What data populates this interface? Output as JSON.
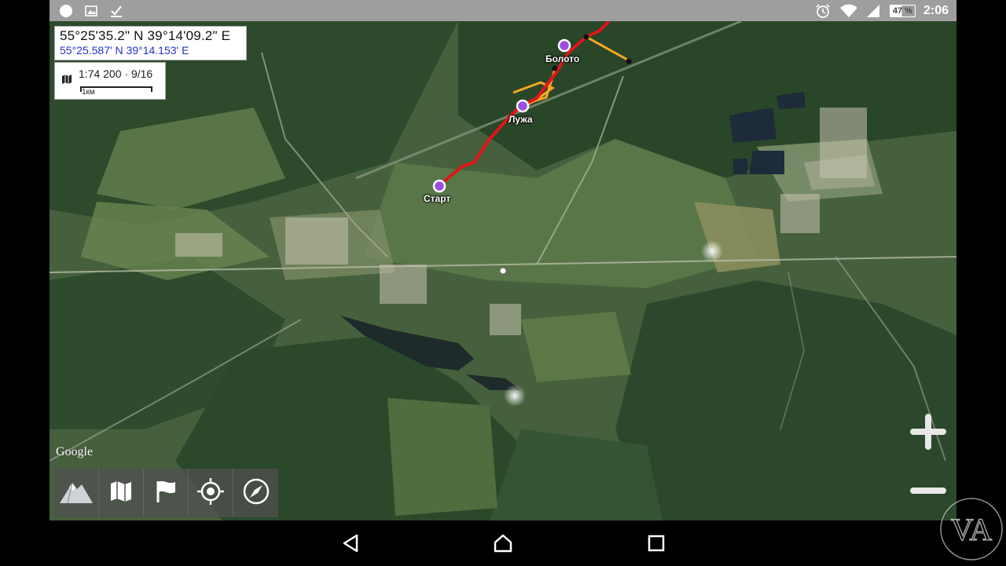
{
  "status_bar": {
    "left_icons": [
      "circle-icon",
      "image-icon",
      "check-download-icon"
    ],
    "right_icons": [
      "alarm-icon",
      "wifi-icon",
      "signal-icon"
    ],
    "battery_label": "47 %",
    "time": "2:06",
    "background_color": "#9e9e9e"
  },
  "coords": {
    "dms": "55°25'35.2\" N 39°14'09.2\" E",
    "decimal": "55°25.587' N 39°14.153' E",
    "decimal_color": "#2233cc"
  },
  "scale": {
    "ratio": "1:74 200 · 9/16",
    "bar_label": "1км"
  },
  "map": {
    "provider_label": "Google",
    "waypoints": [
      {
        "label": "Старт"
      },
      {
        "label": "Лужа"
      },
      {
        "label": "Болото"
      }
    ],
    "track_color": "#e0161b",
    "route_color": "#f5a623",
    "waypoint_color": "#9b4fe0"
  },
  "toolbar": {
    "buttons": [
      {
        "name": "mountain-icon"
      },
      {
        "name": "map-icon"
      },
      {
        "name": "flag-icon"
      },
      {
        "name": "location-target-icon"
      },
      {
        "name": "compass-icon"
      }
    ]
  },
  "zoom": {
    "in_icon": "plus-icon",
    "out_icon": "minus-icon"
  },
  "nav_bar": {
    "back_icon": "back-icon",
    "home_icon": "home-icon",
    "recents_icon": "recents-icon"
  },
  "watermark": {
    "text": "VA"
  }
}
